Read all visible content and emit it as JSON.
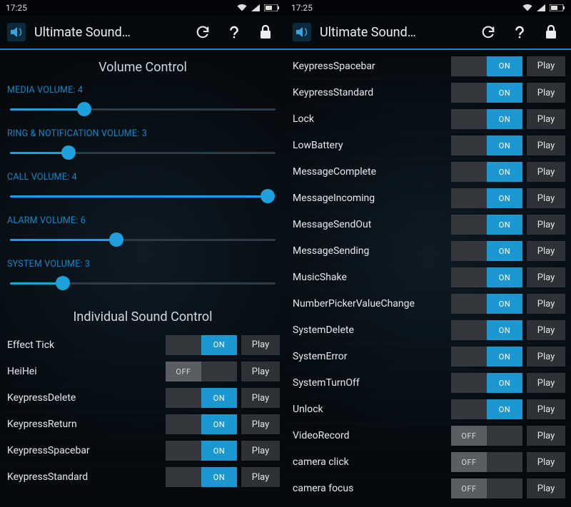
{
  "status": {
    "time": "17:25"
  },
  "app": {
    "title": "Ultimate Sound…"
  },
  "labels": {
    "on": "ON",
    "off": "OFF",
    "play": "Play"
  },
  "sections": {
    "volume": "Volume Control",
    "individual": "Individual Sound Control"
  },
  "volumes": [
    {
      "label": "MEDIA VOLUME: 4",
      "fill": 28
    },
    {
      "label": "RING & NOTIFICATION VOLUME: 3",
      "fill": 22
    },
    {
      "label": "CALL VOLUME: 4",
      "fill": 97
    },
    {
      "label": "ALARM VOLUME: 6",
      "fill": 40
    },
    {
      "label": "SYSTEM VOLUME: 3",
      "fill": 20
    }
  ],
  "left_sounds": [
    {
      "name": "Effect Tick",
      "on": true
    },
    {
      "name": "HeiHei",
      "on": false
    },
    {
      "name": "KeypressDelete",
      "on": true
    },
    {
      "name": "KeypressReturn",
      "on": true
    },
    {
      "name": "KeypressSpacebar",
      "on": true
    },
    {
      "name": "KeypressStandard",
      "on": true
    }
  ],
  "right_sounds": [
    {
      "name": "KeypressSpacebar",
      "on": true
    },
    {
      "name": "KeypressStandard",
      "on": true
    },
    {
      "name": "Lock",
      "on": true
    },
    {
      "name": "LowBattery",
      "on": true
    },
    {
      "name": "MessageComplete",
      "on": true
    },
    {
      "name": "MessageIncoming",
      "on": true
    },
    {
      "name": "MessageSendOut",
      "on": true
    },
    {
      "name": "MessageSending",
      "on": true
    },
    {
      "name": "MusicShake",
      "on": true
    },
    {
      "name": "NumberPickerValueChange",
      "on": true
    },
    {
      "name": "SystemDelete",
      "on": true
    },
    {
      "name": "SystemError",
      "on": true
    },
    {
      "name": "SystemTurnOff",
      "on": true
    },
    {
      "name": "Unlock",
      "on": true
    },
    {
      "name": "VideoRecord",
      "on": false
    },
    {
      "name": "camera click",
      "on": false
    },
    {
      "name": "camera focus",
      "on": false
    }
  ]
}
